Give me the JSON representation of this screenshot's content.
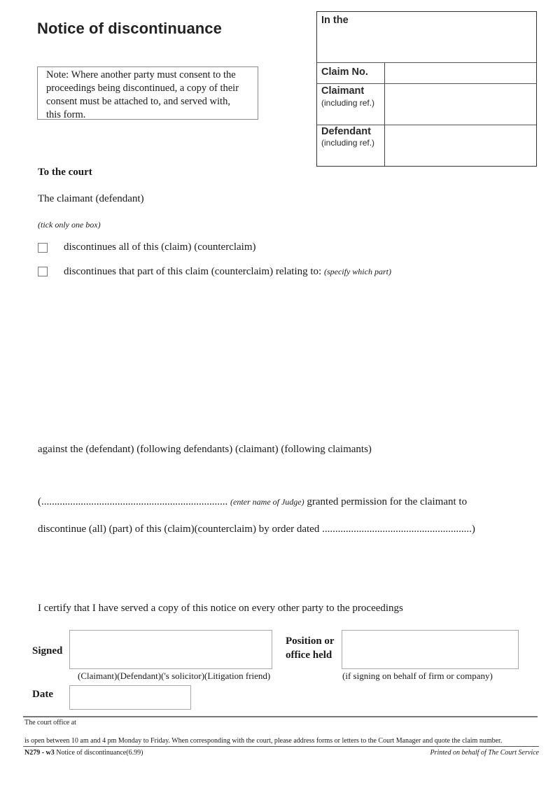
{
  "document": {
    "title": "Notice of discontinuance",
    "note_lines": [
      "Note: Where another party must consent to the",
      "proceedings being discontinued, a copy of their",
      "consent must be attached to, and served with,",
      "this form."
    ]
  },
  "court_box": {
    "in_the_label": "In the",
    "in_the_value": "",
    "claim_no_label": "Claim No.",
    "claim_no_value": "",
    "claimant_label": "Claimant",
    "claimant_sub": "(including ref.)",
    "claimant_value": "",
    "defendant_label": "Defendant",
    "defendant_sub": "(including ref.)",
    "defendant_value": ""
  },
  "body": {
    "to_the_court": "To the court",
    "party_line": "The claimant (defendant)",
    "tick_hint": "(tick only one box)",
    "options": [
      {
        "label": "discontinues all of this (claim) (counterclaim)",
        "hint": "",
        "checked": false
      },
      {
        "label": "discontinues that part of this claim (counterclaim) relating to:",
        "hint": "(specify which part)",
        "checked": false
      }
    ],
    "against_line": "against the (defendant) (following defendants) (claimant) (following claimants)",
    "judge_line_open": "(.......................................................................",
    "judge_hint": "(enter name of Judge)",
    "judge_line_rest": "granted permission for the claimant to",
    "order_line": "discontinue (all) (part) of this (claim)(counterclaim) by order dated .........................................................)",
    "certify_line": "I certify that I have served a copy of this notice on every other party to the proceedings"
  },
  "signature": {
    "signed_label": "Signed",
    "signed_caption": "(Claimant)(Defendant)('s solicitor)(Litigation friend)",
    "position_label_1": "Position or",
    "position_label_2": "office held",
    "position_caption": "(if signing on behalf of firm or company)",
    "date_label": "Date"
  },
  "footer": {
    "court_office": "The court office at",
    "opening_hours": "is open between 10 am and 4 pm Monday to Friday.  When corresponding with the court, please address forms or letters to the Court Manager and quote the claim number.",
    "form_code": "N279 - w3",
    "form_name": "Notice of discontinuance(6.99)",
    "printed_by": "Printed on behalf of The Court Service"
  }
}
